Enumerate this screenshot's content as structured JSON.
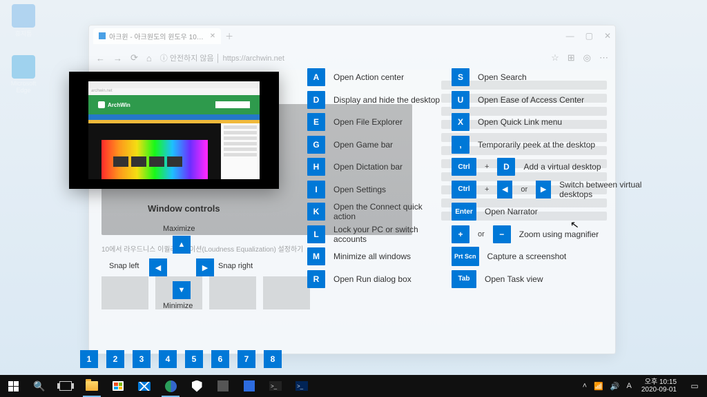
{
  "desktop": {
    "icon1": "휴지통",
    "icon2": "Microsoft Edge"
  },
  "browser": {
    "tab_title": "아크윈 - 아크원도의 윈도우 10…",
    "security_label": "안전하지 않음",
    "url": "https://archwin.net",
    "winbtns": {
      "min": "—",
      "max": "▢",
      "close": "✕"
    },
    "nav": {
      "back": "←",
      "fwd": "→",
      "reload": "⟳",
      "home": "⌂",
      "menu": "⋯",
      "fav": "☆",
      "ext": "⊞",
      "user": "◎"
    },
    "content_caption": "10에서 라우드니스 이퀄라이제이션(Loudness Equalization) 설정하기"
  },
  "preview": {
    "brand": "ArchWin",
    "addr": "archwin.net"
  },
  "hud": {
    "window_controls_title": "Window controls",
    "wc": {
      "up": {
        "glyph": "▲",
        "label": "Maximize"
      },
      "down": {
        "glyph": "▼",
        "label": "Minimize"
      },
      "left": {
        "glyph": "◀",
        "label": "Snap left"
      },
      "right": {
        "glyph": "▶",
        "label": "Snap right"
      }
    },
    "col1": [
      {
        "key": "A",
        "desc": "Open Action center"
      },
      {
        "key": "D",
        "desc": "Display and hide the desktop"
      },
      {
        "key": "E",
        "desc": "Open File Explorer"
      },
      {
        "key": "G",
        "desc": "Open Game bar"
      },
      {
        "key": "H",
        "desc": "Open Dictation bar"
      },
      {
        "key": "I",
        "desc": "Open Settings"
      },
      {
        "key": "K",
        "desc": "Open the Connect quick action"
      },
      {
        "key": "L",
        "desc": "Lock your PC or switch accounts"
      },
      {
        "key": "M",
        "desc": "Minimize all windows"
      },
      {
        "key": "R",
        "desc": "Open Run dialog box"
      }
    ],
    "col2_simple": [
      {
        "key": "S",
        "desc": "Open Search"
      },
      {
        "key": "U",
        "desc": "Open Ease of Access Center"
      },
      {
        "key": "X",
        "desc": "Open Quick Link menu"
      },
      {
        "key": ",",
        "desc": "Temporarily peek at the desktop"
      }
    ],
    "ctrl_d": {
      "k1": "Ctrl",
      "join": "+",
      "k2": "D",
      "desc": "Add a virtual desktop"
    },
    "ctrl_arrows": {
      "k1": "Ctrl",
      "join1": "+",
      "k2": "◀",
      "or": "or",
      "k3": "▶",
      "desc": "Switch between virtual desktops"
    },
    "enter": {
      "k": "Enter",
      "desc": "Open Narrator"
    },
    "zoom": {
      "k1": "+",
      "or": "or",
      "k2": "−",
      "desc": "Zoom using magnifier"
    },
    "prtscn": {
      "k": "Prt Scn",
      "desc": "Capture a screenshot"
    },
    "tab": {
      "k": "Tab",
      "desc": "Open Task view"
    },
    "numbers": [
      "1",
      "2",
      "3",
      "4",
      "5",
      "6",
      "7",
      "8"
    ]
  },
  "taskbar": {
    "tray": {
      "up": "˄",
      "net": "📶",
      "vol": "🔊",
      "lang": "A"
    },
    "clock": {
      "time": "오후 10:15",
      "date": "2020-09-01"
    },
    "notif": "▭"
  }
}
